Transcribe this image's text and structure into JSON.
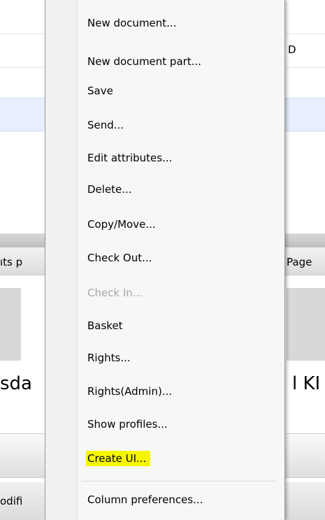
{
  "background": {
    "fragments": {
      "row2_right": "D",
      "col_left": "ıts p",
      "col_right": "Page",
      "text_left": "sda",
      "text_right": "l KI",
      "bottom_left": "odifi"
    }
  },
  "context_menu": {
    "items": [
      {
        "label": "New document...",
        "enabled": true
      },
      {
        "label": "New document part...",
        "enabled": true
      },
      {
        "label": "Save",
        "enabled": true
      },
      {
        "label": "Send...",
        "enabled": true
      },
      {
        "label": "Edit attributes...",
        "enabled": true
      },
      {
        "label": "Delete...",
        "enabled": true
      },
      {
        "label": "Copy/Move...",
        "enabled": true
      },
      {
        "label": "Check Out...",
        "enabled": true
      },
      {
        "label": "Check In...",
        "enabled": false
      },
      {
        "label": "Basket",
        "enabled": true
      },
      {
        "label": "Rights...",
        "enabled": true
      },
      {
        "label": "Rights(Admin)...",
        "enabled": true
      },
      {
        "label": "Show profiles...",
        "enabled": true
      },
      {
        "label": "Create UI...",
        "enabled": true,
        "highlighted": true
      },
      {
        "label": "Column preferences...",
        "enabled": true
      }
    ],
    "highlight_color": "#f6f600",
    "disabled_color": "#a7a7a7"
  }
}
